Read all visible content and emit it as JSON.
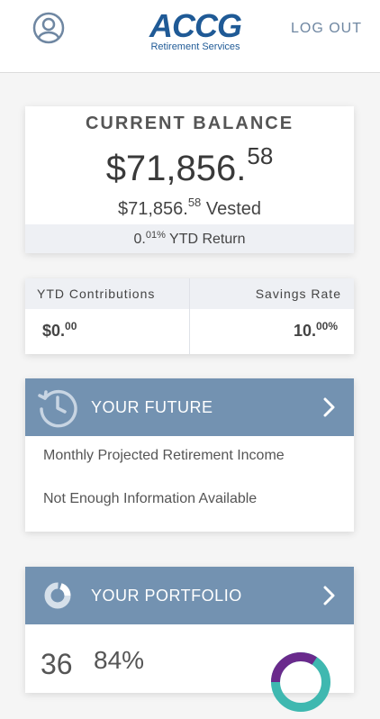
{
  "header": {
    "logo_main": "ACCG",
    "logo_sub": "Retirement Services",
    "logout_label": "LOG OUT",
    "avatar_icon": "user-circle-icon"
  },
  "balance": {
    "title": "CURRENT BALANCE",
    "amount_whole": "$71,856.",
    "amount_cents": "58",
    "vested_whole": "$71,856.",
    "vested_cents": "58",
    "vested_label": " Vested",
    "ytd_return_whole": "0.",
    "ytd_return_fraction": "01%",
    "ytd_return_label": " YTD Return"
  },
  "stats": {
    "contributions_label": "YTD Contributions",
    "contributions_whole": "$0.",
    "contributions_cents": "00",
    "savings_label": "Savings Rate",
    "savings_whole": "10.",
    "savings_fraction": "00%"
  },
  "future": {
    "title": "YOUR FUTURE",
    "icon": "clock-history-icon",
    "line1": "Monthly Projected Retirement Income",
    "line2": "Not Enough Information Available"
  },
  "portfolio": {
    "title": "YOUR PORTFOLIO",
    "icon": "donut-chart-icon",
    "number": "36",
    "percent": "84%"
  },
  "colors": {
    "brand": "#1f5a96",
    "panel_header": "#7392b1",
    "muted_bg": "#eef0f4",
    "donut_teal": "#3fb8b0",
    "donut_purple": "#6a2a8c"
  }
}
